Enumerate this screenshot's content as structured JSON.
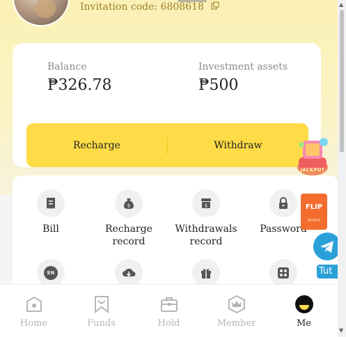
{
  "profile": {
    "invitation_code": "Invitation code: 6808618"
  },
  "balance": {
    "label": "Balance",
    "value": "₱326.78"
  },
  "investment": {
    "label": "Investment assets",
    "value": "₱500"
  },
  "actions": {
    "recharge": "Recharge",
    "withdraw": "Withdraw"
  },
  "menu": {
    "row1": [
      {
        "label": "Bill",
        "icon": "bill-icon"
      },
      {
        "label": "Recharge record",
        "icon": "money-bag-icon"
      },
      {
        "label": "Withdrawals record",
        "icon": "withdraw-box-icon"
      },
      {
        "label": "Password",
        "icon": "lock-icon"
      }
    ],
    "row2": [
      {
        "icon": "language-en-icon",
        "badge": "EN"
      },
      {
        "icon": "download-cloud-icon"
      },
      {
        "icon": "gift-icon"
      },
      {
        "icon": "apps-grid-icon"
      }
    ]
  },
  "nav": [
    {
      "label": "Home",
      "icon": "home-icon"
    },
    {
      "label": "Funds",
      "icon": "bookmark-icon"
    },
    {
      "label": "Hold",
      "icon": "briefcase-icon"
    },
    {
      "label": "Member",
      "icon": "crown-icon"
    },
    {
      "label": "Me",
      "icon": "me-face-icon",
      "active": true
    }
  ],
  "floating": {
    "jackpot": "JACKPOT",
    "flip": "FLIP",
    "flip_sub": "BONUS",
    "tut": "Tut"
  },
  "colors": {
    "accent": "#fddc47",
    "background_top": "#fbf1b5",
    "telegram": "#2aa0d8",
    "flip": "#f46d2e"
  }
}
